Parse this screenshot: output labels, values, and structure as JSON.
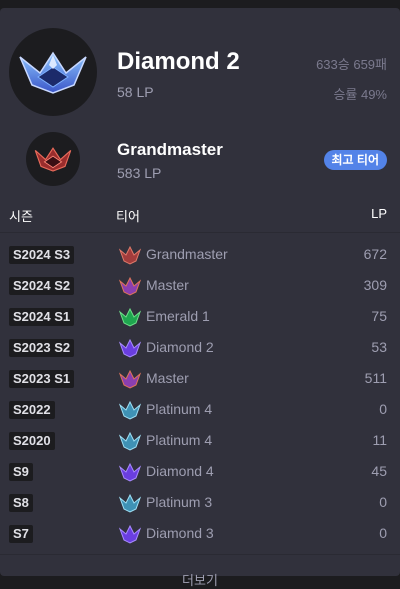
{
  "current": {
    "tier": "Diamond 2",
    "lp": "58 LP",
    "win_loss": "633승 659패",
    "win_rate": "승률 49%"
  },
  "peak": {
    "tier": "Grandmaster",
    "lp": "583 LP",
    "badge": "최고 티어"
  },
  "table": {
    "headers": {
      "season": "시즌",
      "tier": "티어",
      "lp": "LP"
    },
    "rows": [
      {
        "season": "S2024 S3",
        "tier": "Grandmaster",
        "lp": "672",
        "icon": "grandmaster-emblem-icon"
      },
      {
        "season": "S2024 S2",
        "tier": "Master",
        "lp": "309",
        "icon": "master-emblem-icon"
      },
      {
        "season": "S2024 S1",
        "tier": "Emerald 1",
        "lp": "75",
        "icon": "emerald-emblem-icon"
      },
      {
        "season": "S2023 S2",
        "tier": "Diamond 2",
        "lp": "53",
        "icon": "diamond-emblem-icon"
      },
      {
        "season": "S2023 S1",
        "tier": "Master",
        "lp": "511",
        "icon": "master-emblem-icon"
      },
      {
        "season": "S2022",
        "tier": "Platinum 4",
        "lp": "0",
        "icon": "platinum-emblem-icon"
      },
      {
        "season": "S2020",
        "tier": "Platinum 4",
        "lp": "11",
        "icon": "platinum-emblem-icon"
      },
      {
        "season": "S9",
        "tier": "Diamond 4",
        "lp": "45",
        "icon": "diamond-emblem-icon"
      },
      {
        "season": "S8",
        "tier": "Platinum 3",
        "lp": "0",
        "icon": "platinum-emblem-icon"
      },
      {
        "season": "S7",
        "tier": "Diamond 3",
        "lp": "0",
        "icon": "diamond-emblem-icon"
      }
    ]
  },
  "footer": {
    "more_label": "더보기"
  },
  "colors": {
    "background": "#1c1c1f",
    "card": "#31313c",
    "badge": "#5383e8",
    "muted_text": "#9e9eb1",
    "grandmaster": "#c0504a",
    "master": "#a24fc4",
    "emerald": "#1fb25a",
    "diamond": "#7b4ce6",
    "platinum": "#4fa6c7"
  }
}
